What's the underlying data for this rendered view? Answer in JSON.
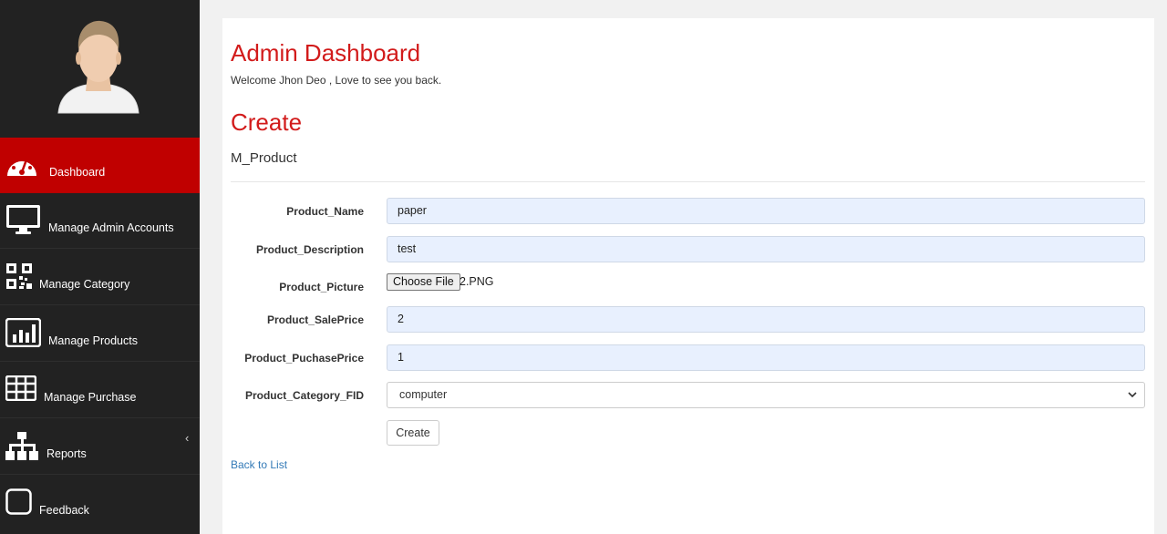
{
  "sidebar": {
    "items": [
      {
        "label": "Dashboard",
        "icon": "dashboard-gauge-icon",
        "active": true
      },
      {
        "label": "Manage Admin Accounts",
        "icon": "monitor-icon"
      },
      {
        "label": "Manage Category",
        "icon": "qr-code-icon"
      },
      {
        "label": "Manage Products",
        "icon": "bar-chart-icon"
      },
      {
        "label": "Manage Purchase",
        "icon": "table-grid-icon"
      },
      {
        "label": "Reports",
        "icon": "sitemap-icon"
      },
      {
        "label": "Feedback",
        "icon": "square-icon"
      }
    ],
    "collapse_glyph": "‹"
  },
  "header": {
    "title": "Admin Dashboard",
    "welcome": "Welcome Jhon Deo , Love to see you back."
  },
  "form": {
    "title": "Create",
    "subtitle": "M_Product",
    "fields": {
      "product_name": {
        "label": "Product_Name",
        "value": "paper"
      },
      "product_description": {
        "label": "Product_Description",
        "value": "test"
      },
      "product_picture": {
        "label": "Product_Picture",
        "button": "Choose File",
        "file": "2.PNG"
      },
      "product_saleprice": {
        "label": "Product_SalePrice",
        "value": "2"
      },
      "product_puchaseprice": {
        "label": "Product_PuchasePrice",
        "value": "1"
      },
      "product_category_fid": {
        "label": "Product_Category_FID",
        "value": "computer"
      }
    },
    "submit_label": "Create",
    "back_link": "Back to List"
  },
  "colors": {
    "accent": "#d21b1b",
    "active_nav": "#c00000",
    "sidebar_bg": "#222222",
    "input_autofill_bg": "#e8f0fe",
    "link": "#337ab7"
  }
}
